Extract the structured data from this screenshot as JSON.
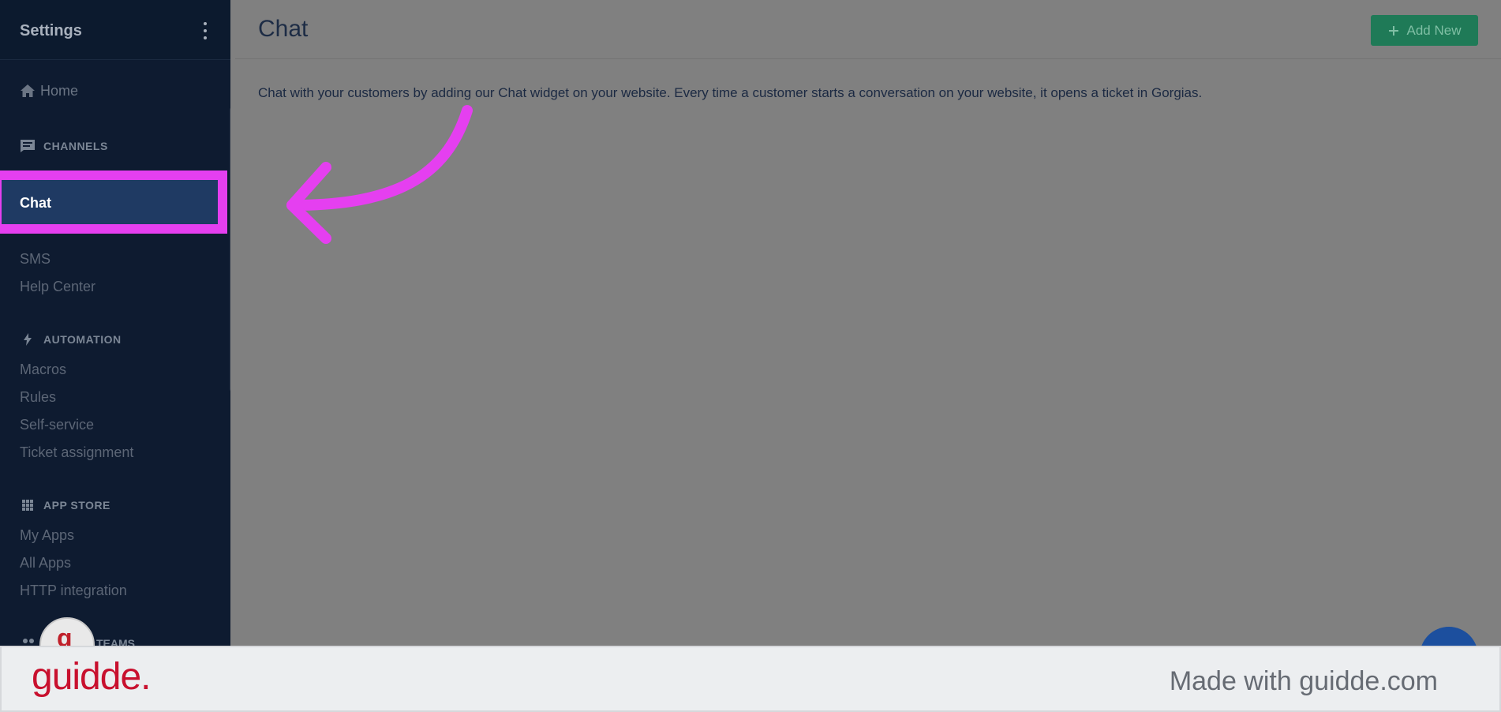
{
  "sidebar": {
    "title": "Settings",
    "home": "Home",
    "sections": {
      "channels": "CHANNELS",
      "automation": "AUTOMATION",
      "app_store": "APP STORE",
      "teams": "TEAMS"
    },
    "channels_items": [
      "Chat",
      "SMS",
      "Help Center"
    ],
    "automation_items": [
      "Macros",
      "Rules",
      "Self-service",
      "Ticket assignment"
    ],
    "app_store_items": [
      "My Apps",
      "All Apps",
      "HTTP integration"
    ],
    "active_item": "Chat",
    "avatar_letter": "g"
  },
  "main": {
    "title": "Chat",
    "add_button": "Add New",
    "description": "Chat with your customers by adding our Chat widget on your website. Every time a customer starts a conversation on your website, it opens a ticket in Gorgias."
  },
  "footer": {
    "logo": "guidde.",
    "made_with": "Made with guidde.com"
  },
  "colors": {
    "sidebar_bg": "#0e1b30",
    "active_bg": "#1f3a63",
    "highlight": "#e53ff0",
    "add_button": "#1f7a57",
    "logo": "#c8102e"
  }
}
